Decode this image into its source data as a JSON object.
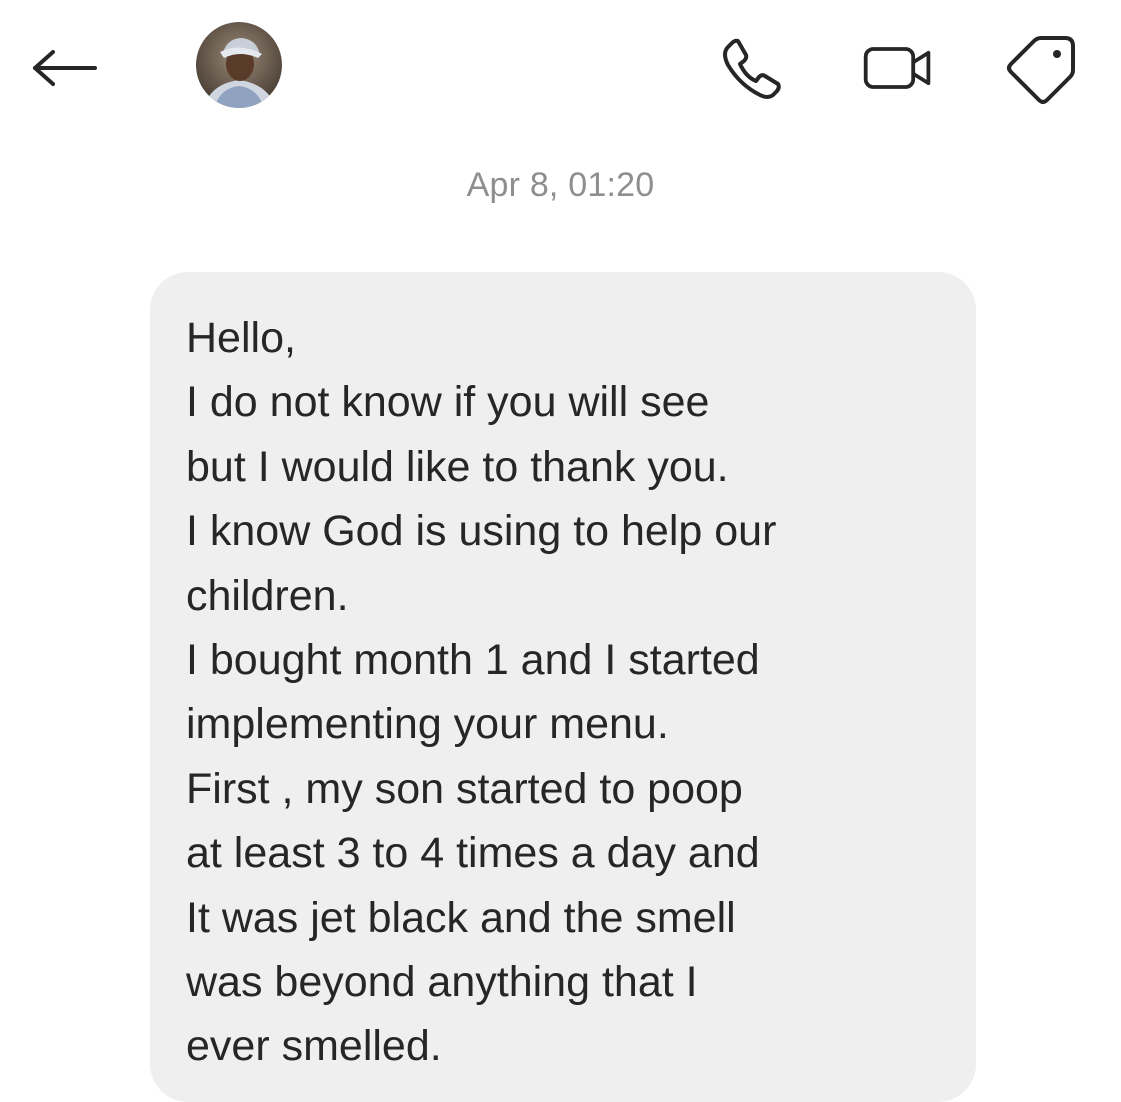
{
  "header": {
    "back_icon": "arrow-left-icon",
    "avatar_icon": "profile-avatar",
    "actions": [
      "phone-icon",
      "video-camera-icon",
      "tag-icon"
    ]
  },
  "thread": {
    "timestamp": "Apr 8, 01:20",
    "message": {
      "text": "Hello,\nI do not know if you will see\nbut I would like to thank you.\nI know God is using to help our\nchildren.\nI bought month 1 and I started\nimplementing your menu.\nFirst , my son started to poop\nat least 3 to 4 times a day and\nIt was jet black and the smell\nwas beyond anything that I\never smelled."
    }
  },
  "colors": {
    "text": "#262626",
    "timestamp": "#8e8e8e",
    "bubble": "#efefef",
    "background": "#ffffff"
  }
}
